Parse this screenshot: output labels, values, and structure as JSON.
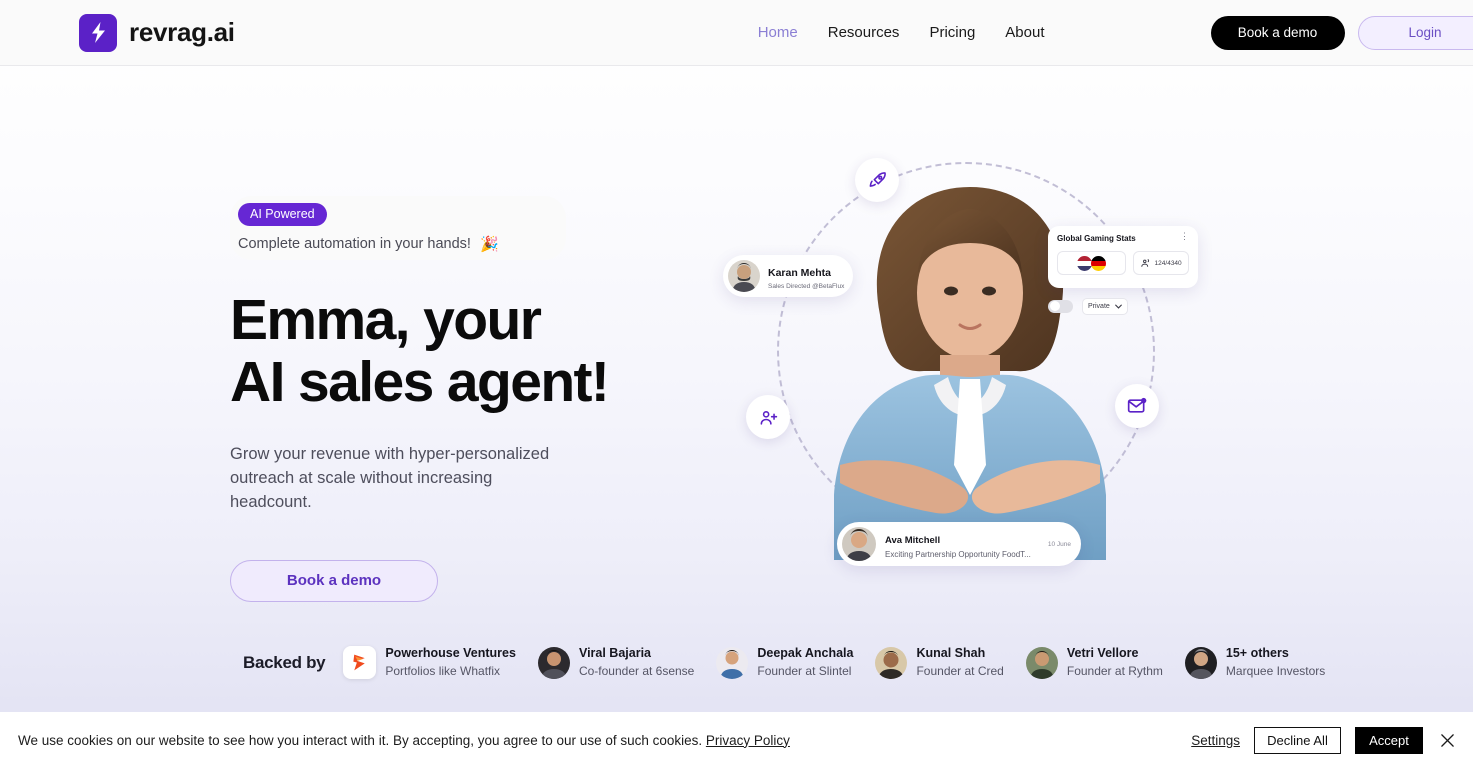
{
  "header": {
    "brand_name": "revrag.ai",
    "nav": [
      {
        "label": "Home",
        "active": true
      },
      {
        "label": "Resources",
        "active": false
      },
      {
        "label": "Pricing",
        "active": false
      },
      {
        "label": "About",
        "active": false
      }
    ],
    "book_demo_label": "Book a demo",
    "login_label": "Login"
  },
  "hero": {
    "badge_pill": "AI Powered",
    "badge_text": "Complete automation in your hands!",
    "badge_emoji": "🎉",
    "title_line1": "Emma, your",
    "title_line2": "AI sales agent!",
    "subtitle": "Grow your revenue with hyper-personalized outreach at scale without increasing headcount.",
    "cta_label": "Book a demo"
  },
  "visual": {
    "person_card": {
      "name": "Karan Mehta",
      "role": "Sales Directed @BetaFlux"
    },
    "stats_card": {
      "title": "Global Gaming Stats",
      "menu_icon": "kebab-menu-icon",
      "flags": [
        "united-states-flag",
        "germany-flag"
      ],
      "members_icon": "people-icon",
      "members_count": "124/4340"
    },
    "privacy": {
      "toggle_state": "off",
      "visibility": "Private"
    },
    "mail_card": {
      "name": "Ava Mitchell",
      "subject": "Exciting Partnership Opportunity FoodT...",
      "date": "10 June"
    },
    "orbit_icons": [
      "rocket-icon",
      "add-user-icon",
      "mail-notification-icon"
    ]
  },
  "backed": {
    "label": "Backed by",
    "investors": [
      {
        "name": "Powerhouse Ventures",
        "role": "Portfolios like Whatfix",
        "avatar": "logo"
      },
      {
        "name": "Viral Bajaria",
        "role": "Co-founder at 6sense",
        "avatar": "photo"
      },
      {
        "name": "Deepak Anchala",
        "role": "Founder at Slintel",
        "avatar": "photo"
      },
      {
        "name": "Kunal Shah",
        "role": "Founder at Cred",
        "avatar": "photo"
      },
      {
        "name": "Vetri Vellore",
        "role": "Founder at Rythm",
        "avatar": "photo"
      },
      {
        "name": "15+ others",
        "role": "Marquee Investors",
        "avatar": "photo"
      }
    ]
  },
  "cookie": {
    "message": "We use cookies on our website to see how you interact with it. By accepting, you agree to our use of such cookies.",
    "policy_link": "Privacy Policy",
    "settings_label": "Settings",
    "decline_label": "Decline All",
    "accept_label": "Accept",
    "close_icon": "close-icon"
  },
  "colors": {
    "brand_purple": "#6627d4",
    "accent_light": "#f0ebfd",
    "nav_active": "#8b7fd4",
    "black": "#000000"
  }
}
